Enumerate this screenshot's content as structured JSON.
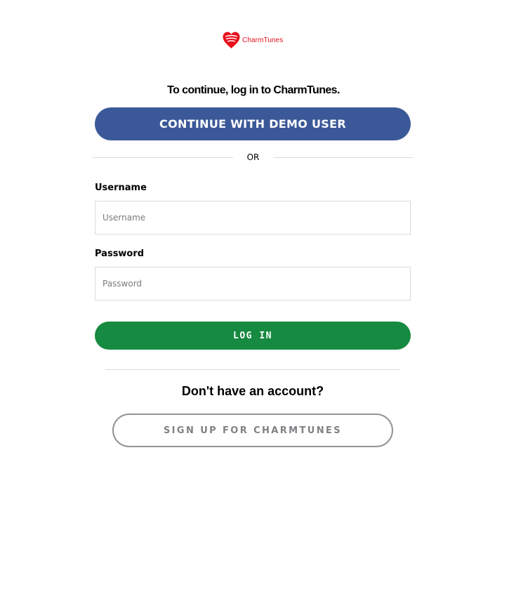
{
  "header": {
    "logo_icon": "heart-logo-icon",
    "logo_text": "CharmTunes",
    "brand_color": "#e8101c"
  },
  "login": {
    "intro": "To continue, log in to CharmTunes.",
    "demo_button_label": "CONTINUE WITH DEMO USER",
    "demo_button_color": "#3b5998",
    "divider_text": "OR",
    "username": {
      "label": "Username",
      "placeholder": "Username",
      "value": ""
    },
    "password": {
      "label": "Password",
      "placeholder": "Password",
      "value": ""
    },
    "login_button_label": "LOG IN",
    "login_button_color": "#168a40"
  },
  "signup": {
    "prompt": "Don't have an account?",
    "button_label": "SIGN UP FOR CHARMTUNES"
  }
}
